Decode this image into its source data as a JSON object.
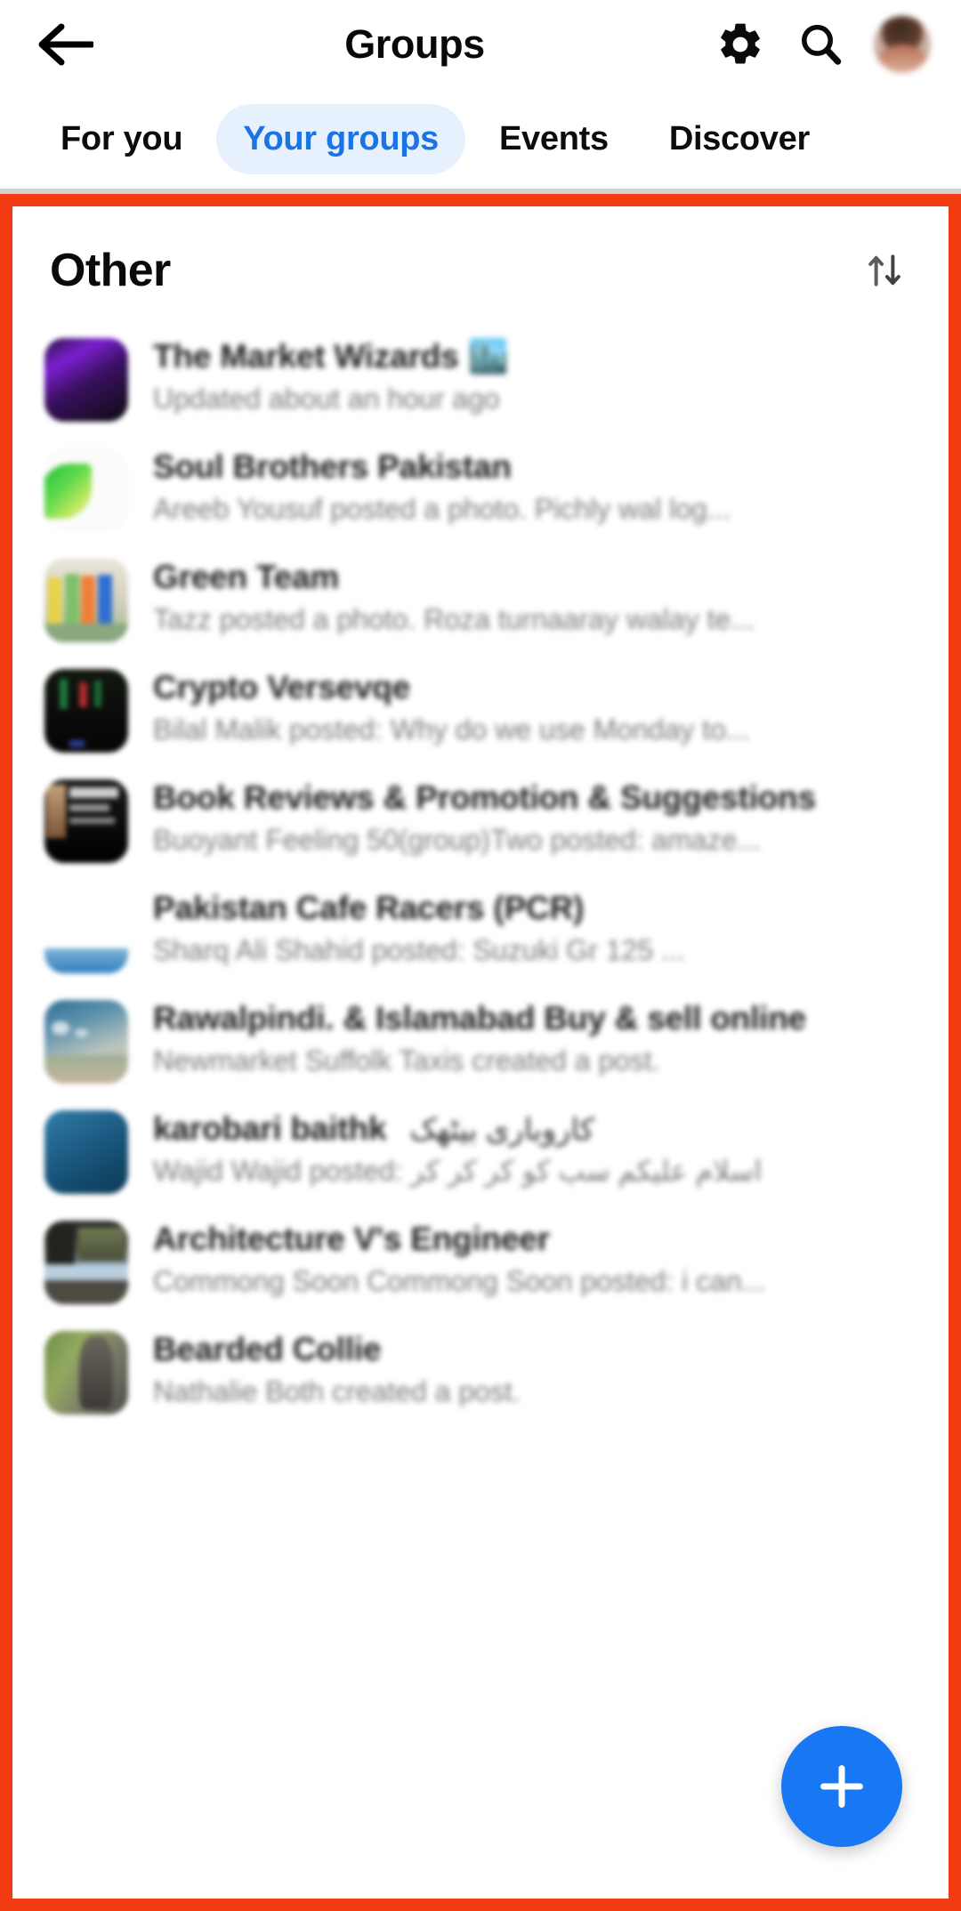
{
  "header": {
    "title": "Groups",
    "back_icon": "back-arrow-icon",
    "settings_icon": "gear-icon",
    "search_icon": "search-icon",
    "avatar_icon": "profile-avatar"
  },
  "tabs": [
    {
      "label": "For you",
      "active": false
    },
    {
      "label": "Your groups",
      "active": true
    },
    {
      "label": "Events",
      "active": false
    },
    {
      "label": "Discover",
      "active": false
    }
  ],
  "section": {
    "title": "Other",
    "sort_icon": "sort-arrows-icon"
  },
  "groups": [
    {
      "name": "The Market Wizards 🏙️",
      "subtitle": "Updated about an hour ago",
      "thumb": "dark-purple-gradient"
    },
    {
      "name": "Soul Brothers Pakistan",
      "subtitle": "Areeb  Yousuf posted a photo. Pichly wal log...",
      "thumb": "white-green-leaf"
    },
    {
      "name": "Green Team",
      "subtitle": "Tazz posted a photo. Roza turnaaray walay te...",
      "thumb": "colorful-people"
    },
    {
      "name": "Crypto Versevqe",
      "subtitle": "Bilal Malik posted: Why do we use Monday to...",
      "thumb": "dark-chart-black"
    },
    {
      "name": "Book Reviews & Promotion & Suggestions",
      "subtitle": "Buoyant Feeling 50(group)Two posted: amaze...",
      "thumb": "black-book-cover"
    },
    {
      "name": "Pakistan Cafe Racers (PCR)",
      "subtitle": "Sharq Ali Shahid posted: Suzuki Gr 125 ...",
      "thumb": "orange-sunset-beach"
    },
    {
      "name": "Rawalpindi. & Islamabad Buy & sell online",
      "subtitle": "Newmarket Suffolk Taxis created a post.",
      "thumb": "blue-landscape-photo"
    },
    {
      "name": "karobari baithk",
      "name_rtl": "کاروباری بیٹھک",
      "subtitle": "Wajid Wajid posted:",
      "subtitle_rtl": "اسلام علیکم سب کو کر کر کر",
      "thumb": "deep-blue-card"
    },
    {
      "name": "Architecture V's Engineer",
      "subtitle": "Commong Soon Commong Soon posted: i can...",
      "thumb": "dark-architecture-photo"
    },
    {
      "name": "Bearded Collie",
      "subtitle": "Nathalie Both created a post.",
      "thumb": "green-dog-photo"
    }
  ],
  "fab": {
    "label": "+",
    "icon": "plus-icon",
    "color": "#1877f2"
  },
  "colors": {
    "accent_blue": "#1b74e4",
    "active_tab_bg": "#e7f0fd",
    "highlight_frame": "#f33b13",
    "subtitle_gray": "#78797c"
  }
}
